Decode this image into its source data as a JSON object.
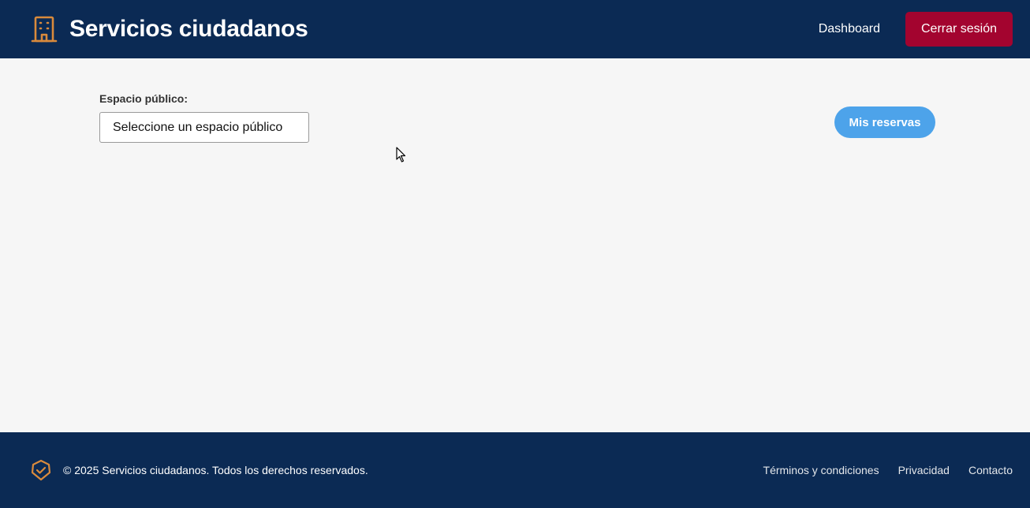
{
  "header": {
    "title": "Servicios ciudadanos",
    "brand_icon": "building-icon",
    "nav": {
      "dashboard_label": "Dashboard",
      "logout_label": "Cerrar sesión"
    }
  },
  "main": {
    "space_label": "Espacio público:",
    "space_select_value": "Seleccione un espacio público",
    "reservations_button_label": "Mis reservas"
  },
  "footer": {
    "icon": "shield-check-icon",
    "copyright": "© 2025 Servicios ciudadanos. Todos los derechos reservados.",
    "links": {
      "terms": "Términos y condiciones",
      "privacy": "Privacidad",
      "contact": "Contacto"
    }
  },
  "colors": {
    "header_bg": "#0b2a54",
    "accent_orange": "#d98a3c",
    "logout_bg": "#a3042f",
    "reservations_bg": "#4da3ea"
  }
}
